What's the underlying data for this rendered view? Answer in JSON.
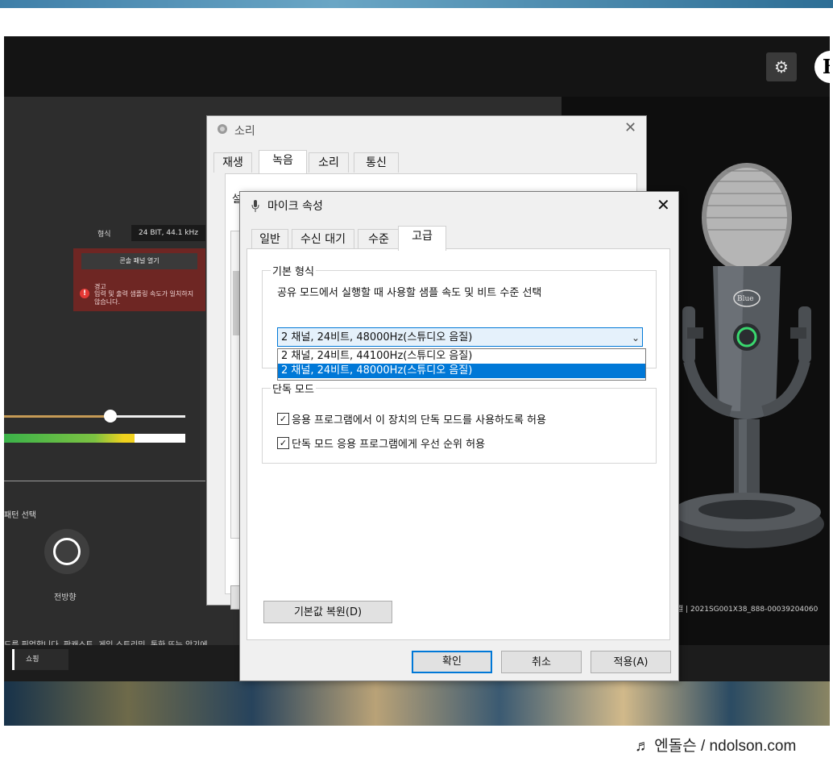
{
  "app": {
    "left_panel": {
      "format_label": "형식",
      "format_value": "24 BIT, 44.1 kHz",
      "open_panel_button": "콘솔 패널 열기",
      "warning_title": "경고",
      "warning_text": "입력 및 출력 샘플링 속도가 일치하지 않습니다.",
      "pattern_label": "패턴 선택",
      "pattern_name": "전방향",
      "description": "드를 픽업합니다. 팟캐스트, 게임 스트리밍, 통화 또는 악기에 적합합니다."
    },
    "right_footer": "결 | 2021SG001X38_888-00039204060",
    "bottom_bar": {
      "shop_label": "쇼핑"
    },
    "icons": {
      "settings": "gear-icon",
      "brand": "blue-logo"
    },
    "brand_letter": "B",
    "gear_glyph": "⚙",
    "warn_glyph": "!",
    "mic_badge": "Blue"
  },
  "sound_dialog": {
    "title": "소리",
    "close": "✕",
    "tabs": [
      "재생",
      "녹음",
      "소리",
      "통신"
    ],
    "panel_text": "설"
  },
  "mic_dialog": {
    "title": "마이크 속성",
    "close": "✕",
    "tabs": [
      "일반",
      "수신 대기",
      "수준",
      "고급"
    ],
    "active_tab": "고급",
    "default_format": {
      "group_label": "기본 형식",
      "description": "공유 모드에서 실행할 때 사용할 샘플 속도 및 비트 수준 선택",
      "selected_value": "2 채널, 24비트, 48000Hz(스튜디오 음질)",
      "chevron": "⌄",
      "options": [
        "2 채널, 24비트, 44100Hz(스튜디오 음질)",
        "2 채널, 24비트, 48000Hz(스튜디오 음질)"
      ]
    },
    "exclusive_mode": {
      "group_label": "단독 모드",
      "checkbox1": "응용 프로그램에서 이 장치의 단독 모드를 사용하도록 허용",
      "checkbox1_checked": true,
      "checkbox2": "단독 모드 응용 프로그램에게 우선 순위 허용",
      "checkbox2_checked": true,
      "check_glyph": "✓"
    },
    "restore_button": "기본값 복원(D)",
    "ok_button": "확인",
    "cancel_button": "취소",
    "apply_button": "적용(A)"
  },
  "watermark": "♬ 엔돌슨 / ndolson.com",
  "colors": {
    "accent": "#0078d7",
    "warning_bg": "#6e2623",
    "slider_fill": "#c59a55"
  }
}
